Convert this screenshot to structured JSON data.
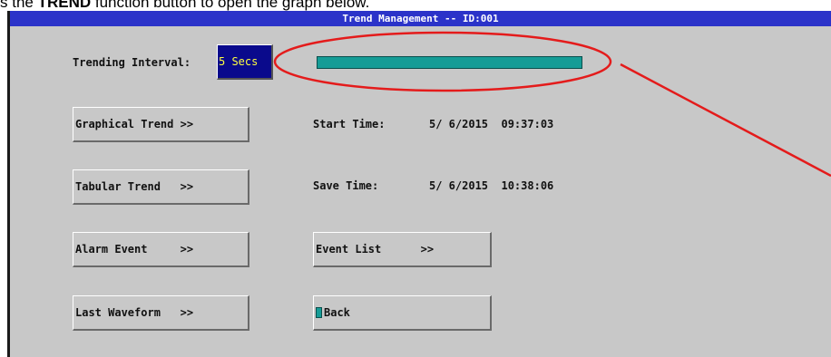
{
  "caption": {
    "prefix": "s the ",
    "bold": "TREND",
    "suffix": " function button to open the graph below."
  },
  "window": {
    "title": "Trend Management -- ID:001"
  },
  "interval": {
    "label": "Trending Interval:",
    "value": "5 Secs"
  },
  "times": {
    "start_label": "Start Time:",
    "start_value": "5/ 6/2015  09:37:03",
    "save_label": "Save Time:",
    "save_value": "5/ 6/2015  10:38:06"
  },
  "buttons": {
    "graphical": "Graphical Trend >>",
    "tabular": "Tabular Trend   >>",
    "alarm": "Alarm Event     >>",
    "event_list": "Event List      >>",
    "last_waveform": "Last Waveform   >>",
    "back": "Back"
  },
  "colors": {
    "title_bar": "#2b33c9",
    "window_bg": "#c8c8c8",
    "interval_bg": "#0a0a8c",
    "interval_text": "#ffff40",
    "progress": "#159c96",
    "annotation": "#e41b1b"
  }
}
